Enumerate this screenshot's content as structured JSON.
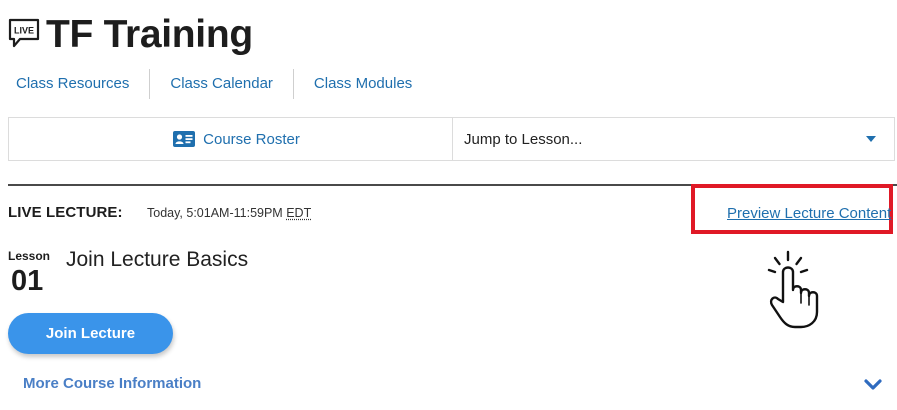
{
  "header": {
    "badge_text": "LIVE",
    "title": "TF Training"
  },
  "nav": {
    "links": [
      {
        "label": "Class Resources"
      },
      {
        "label": "Class Calendar"
      },
      {
        "label": "Class Modules"
      }
    ]
  },
  "toolbar": {
    "roster_label": "Course Roster",
    "roster_icon": "id-card-icon",
    "jump_label": "Jump to Lesson..."
  },
  "live_lecture": {
    "heading": "LIVE LECTURE:",
    "time_prefix": "Today, 5:01AM-11:59PM",
    "timezone": "EDT",
    "preview_label": "Preview Lecture Content",
    "highlight_color": "#e01926"
  },
  "lesson": {
    "word": "Lesson",
    "number": "01",
    "title": "Join Lecture Basics"
  },
  "actions": {
    "join_label": "Join Lecture",
    "more_info_label": "More Course Information"
  },
  "colors": {
    "link": "#1f6fae",
    "button": "#3a94ea",
    "more_info": "#4a7fc6"
  }
}
